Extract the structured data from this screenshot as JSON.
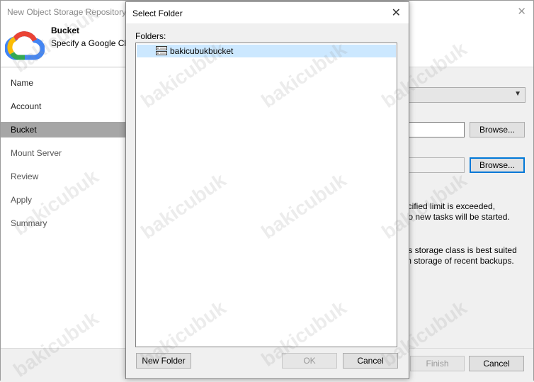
{
  "wizard": {
    "title": "New Object Storage Repository",
    "close_glyph": "✕",
    "header_title": "Bucket",
    "header_subtitle": "Specify a Google Clo",
    "nav": [
      {
        "label": "Name"
      },
      {
        "label": "Account"
      },
      {
        "label": "Bucket"
      },
      {
        "label": "Mount Server"
      },
      {
        "label": "Review"
      },
      {
        "label": "Apply"
      },
      {
        "label": "Summary"
      }
    ],
    "selected_nav": "Bucket",
    "browse1": "Browse...",
    "browse2": "Browse...",
    "limit_text_1": "ecified limit is exceeded,",
    "limit_text_2": "t no new tasks will be started.",
    "storage_text_1": "his storage class is best suited",
    "storage_text_2": "rm storage of recent backups.",
    "finish_label": "Finish",
    "cancel_label": "Cancel"
  },
  "dialog": {
    "title": "Select Folder",
    "close_glyph": "✕",
    "folders_label": "Folders:",
    "folders": [
      {
        "name": "bakicubukbucket",
        "icon": "bucket-icon",
        "selected": true
      }
    ],
    "new_folder_label": "New Folder",
    "ok_label": "OK",
    "cancel_label": "Cancel"
  },
  "watermark_text": "bakicubuk",
  "colors": {
    "selection": "#cce8ff",
    "nav_selected": "#a6a6a6",
    "focus_border": "#0078d7",
    "google_blue": "#4285F4",
    "google_red": "#EA4335",
    "google_yellow": "#FBBC04",
    "google_green": "#34A853"
  }
}
